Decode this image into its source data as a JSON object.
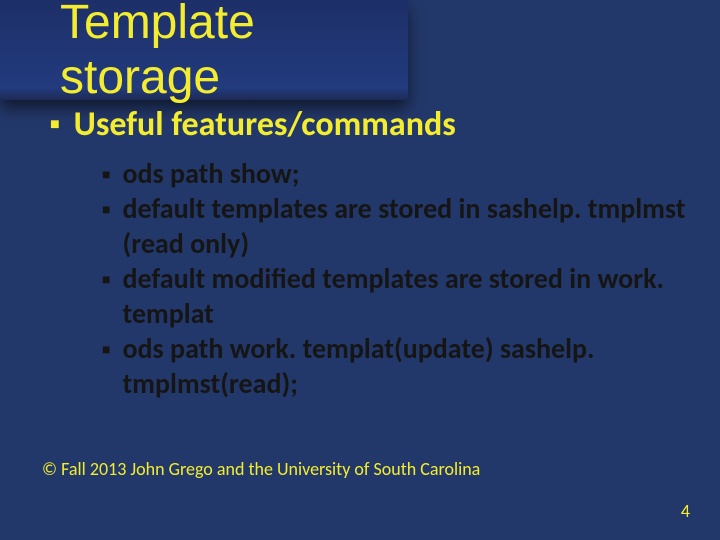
{
  "slide": {
    "title": "Template storage",
    "heading": "Useful features/commands",
    "items": [
      "ods path show;",
      "default templates are stored in sashelp. tmplmst (read only)",
      "default modified templates are stored in work. templat",
      "ods path work. templat(update) sashelp. tmplmst(read);"
    ],
    "credit": "© Fall 2013 John Grego and the University of South Carolina",
    "page_number": "4"
  }
}
